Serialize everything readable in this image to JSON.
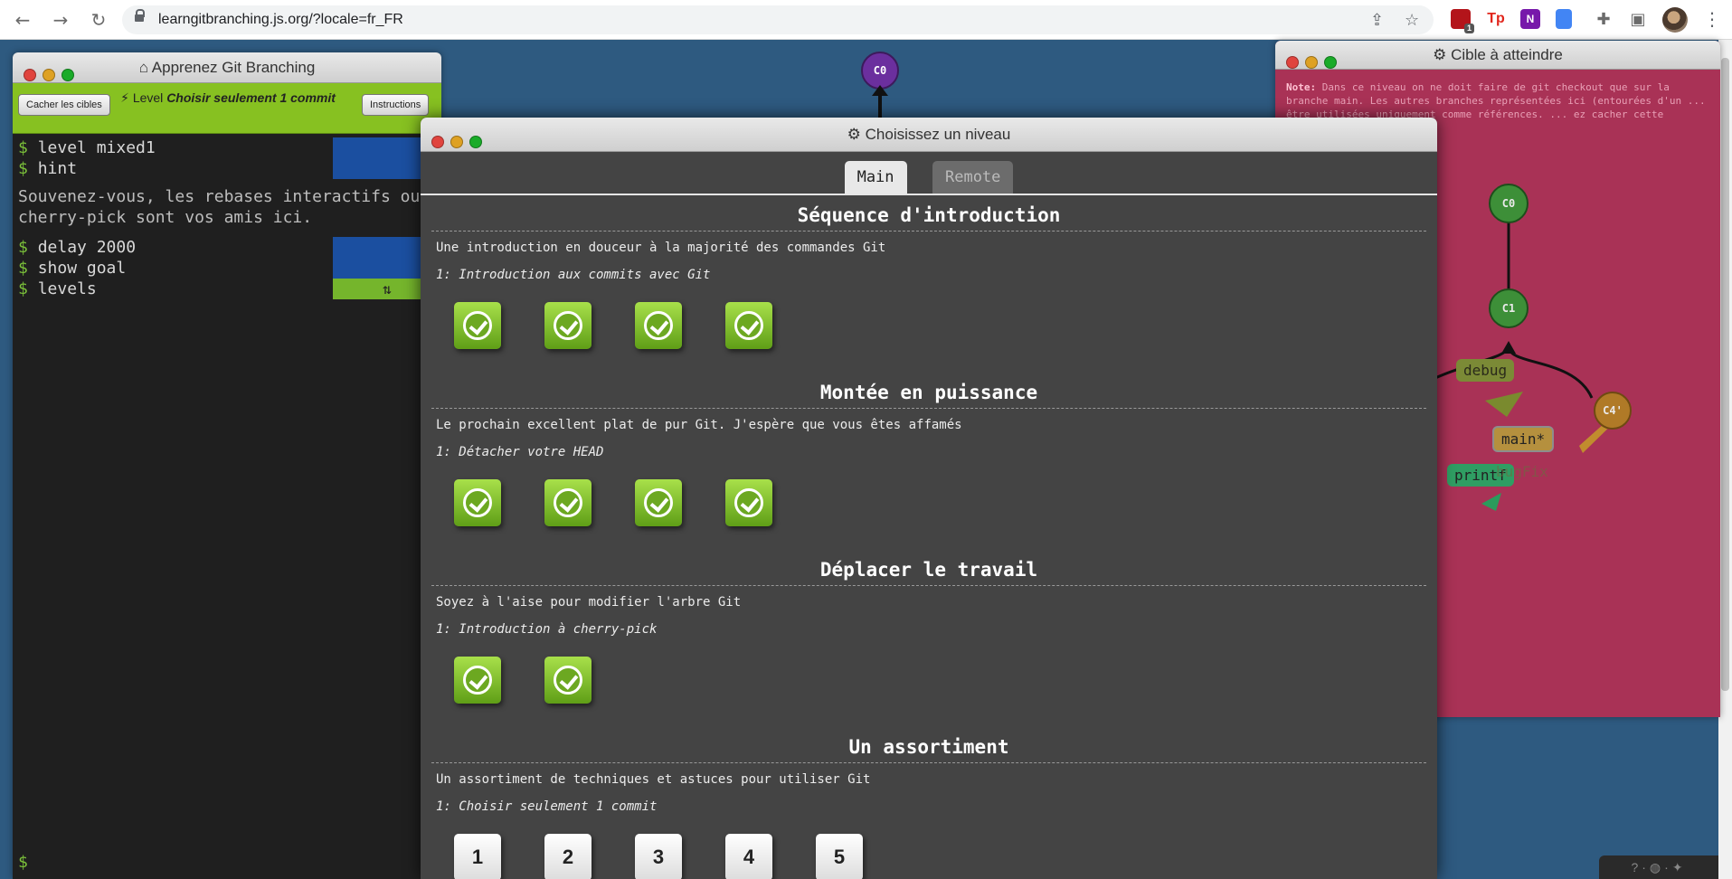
{
  "browser": {
    "url": "learngitbranching.js.org/?locale=fr_FR",
    "ext_badge": "1",
    "ext_tp": "Tp",
    "ext_n": "N"
  },
  "terminal": {
    "title": "Apprenez Git Branching",
    "hide_goal_label": "Cacher les cibles",
    "level_prefix": "Level",
    "level_name": "Choisir seulement 1 commit",
    "instructions_label": "Instructions",
    "commands": [
      {
        "text": "level mixed1"
      },
      {
        "text": "hint"
      },
      {
        "text": "delay 2000"
      },
      {
        "text": "show goal"
      },
      {
        "text": "levels"
      }
    ],
    "message": "Souvenez-vous, les rebases interactifs ou cherry-pick sont vos amis ici.",
    "prompt": "$"
  },
  "canvas": {
    "main_commit": "C0"
  },
  "goal": {
    "title": "Cible à atteindre",
    "note_label": "Note:",
    "note_text": "Dans ce niveau on ne doit faire de git checkout que sur la branche main. Les autres branches représentées ici (entourées d'un ... être utilisées uniquement comme références. ... ez cacher cette fenêtre avec \"Cacher les",
    "commits": [
      "C0",
      "C1",
      "C4'"
    ],
    "branches": [
      "debug",
      "main*",
      "printf",
      "bugFix"
    ]
  },
  "modal": {
    "title": "Choisissez un niveau",
    "tabs": [
      "Main",
      "Remote"
    ],
    "sequences": [
      {
        "title": "Séquence d'introduction",
        "about": "Une introduction en douceur à la majorité des commandes Git",
        "level": "1: Introduction aux commits avec Git"
      },
      {
        "title": "Montée en puissance",
        "about": "Le prochain excellent plat de pur Git. J'espère que vous êtes affamés",
        "level": "1: Détacher votre HEAD"
      },
      {
        "title": "Déplacer le travail",
        "about": "Soyez à l'aise pour modifier l'arbre Git",
        "level": "1: Introduction à cherry-pick"
      },
      {
        "title": "Un assortiment",
        "about": "Un assortiment de techniques et astuces pour utiliser Git",
        "level": "1: Choisir seulement 1 commit"
      }
    ],
    "level_numbers": [
      "1",
      "2",
      "3",
      "4",
      "5"
    ]
  },
  "colors": {
    "canvas_bg": "#2e5a80",
    "goal_bg": "#a93256",
    "toolbar_green": "#87c121",
    "level_complete": "#7bbf2a"
  }
}
